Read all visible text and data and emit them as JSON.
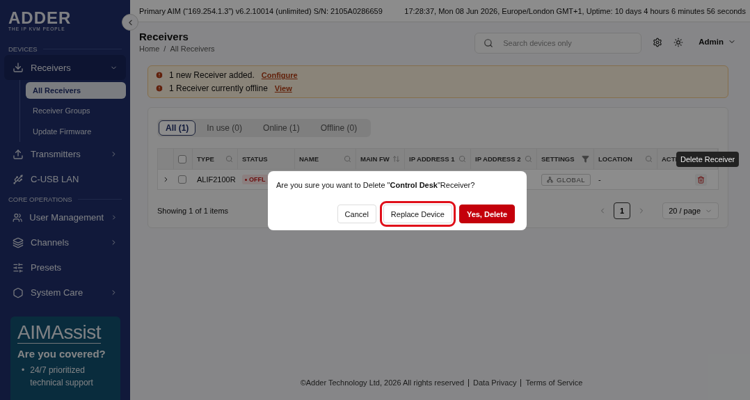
{
  "sidebar": {
    "logo": "ADDER",
    "logo_tagline": "THE IP KVM PEOPLE",
    "sections": [
      {
        "title": "DEVICES",
        "items": [
          {
            "label": "Receivers",
            "expanded": true,
            "children": [
              {
                "label": "All Receivers",
                "selected": true
              },
              {
                "label": "Receiver Groups",
                "selected": false
              },
              {
                "label": "Update Firmware",
                "selected": false
              }
            ]
          },
          {
            "label": "Transmitters",
            "expanded": false
          },
          {
            "label": "C-USB LAN"
          }
        ]
      },
      {
        "title": "CORE OPERATIONS",
        "items": [
          {
            "label": "User Management",
            "expanded": false
          },
          {
            "label": "Channels",
            "expanded": false
          },
          {
            "label": "Presets"
          },
          {
            "label": "System Care",
            "expanded": false
          }
        ]
      }
    ],
    "promo": {
      "brand": "AIMAssist",
      "heading": "Are you covered?",
      "bullets": [
        {
          "marker": "•",
          "text": "24/7 prioritized technical support"
        }
      ]
    }
  },
  "topbar": {
    "info": "Primary AIM (“169.254.1.3”) v6.2.10014 (unlimited) S/N: 2105A0286659",
    "status": "17:28:37, Mon 08 Jun 2026, Europe/London GMT+1, Uptime: 10 days 4 hours 6 minutes 56 seconds"
  },
  "page": {
    "title": "Receivers",
    "breadcrumb": [
      "Home",
      "All Receivers"
    ],
    "breadcrumb_separator": "/",
    "search": {
      "placeholder": "Search devices only"
    },
    "user": "Admin"
  },
  "alerts": [
    {
      "text": "1 new Receiver added.",
      "link": "Configure"
    },
    {
      "text": "1 Receiver currently offline",
      "link": "View"
    }
  ],
  "filters": [
    {
      "label": "All (1)",
      "selected": true
    },
    {
      "label": "In use (0)",
      "selected": false
    },
    {
      "label": "Online (1)",
      "selected": false
    },
    {
      "label": "Offline (0)",
      "selected": false
    }
  ],
  "table": {
    "select_all_checked": false,
    "columns": [
      {
        "label": "TYPE",
        "kind": "search"
      },
      {
        "label": "STATUS",
        "kind": "plain"
      },
      {
        "label": "NAME",
        "kind": "search"
      },
      {
        "label": "MAIN FW",
        "kind": "sort"
      },
      {
        "label": "IP ADDRESS 1",
        "kind": "search"
      },
      {
        "label": "IP ADDRESS 2",
        "kind": "search"
      },
      {
        "label": "SETTINGS",
        "kind": "filter"
      },
      {
        "label": "LOCATION",
        "kind": "search"
      },
      {
        "label": "ACTI",
        "kind": "plain"
      }
    ],
    "rows": [
      {
        "expanded": false,
        "checked": false,
        "type": "ALIF2100R",
        "status": "OFFL",
        "settings": "GLOBAL",
        "location": "-"
      }
    ]
  },
  "pagination": {
    "summary": "Showing 1 of 1 items",
    "pages": [
      {
        "label": "1",
        "selected": true
      }
    ],
    "page_size": "20 / page"
  },
  "tooltip": "Delete Receiver",
  "dialog": {
    "message": "Are you sure you want to Delete \"**Control Desk**\"Receiver?",
    "buttons": [
      {
        "label": "Cancel",
        "kind": "default",
        "highlighted": false
      },
      {
        "label": "Replace Device",
        "kind": "default",
        "highlighted": true
      },
      {
        "label": "Yes, Delete",
        "kind": "danger",
        "highlighted": false
      }
    ]
  },
  "footer": {
    "copyright": "©Adder Technology Ltd, 2026 All rights reserved",
    "links": [
      "Data Privacy",
      "Terms of Service"
    ]
  }
}
